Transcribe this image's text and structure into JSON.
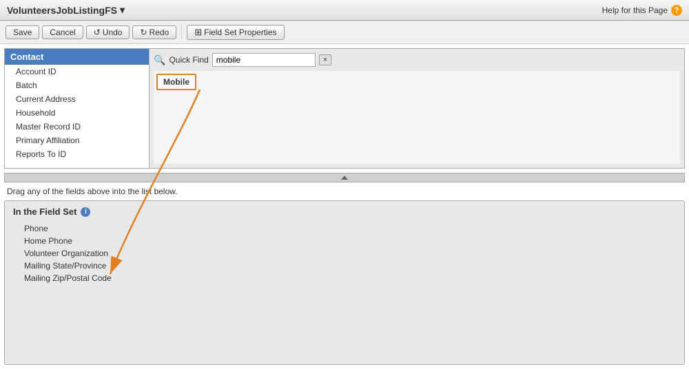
{
  "header": {
    "title": "VolunteersJobListingFS",
    "dropdown_icon": "▾",
    "help_text": "Help for this Page",
    "help_icon": "?"
  },
  "toolbar": {
    "save_label": "Save",
    "cancel_label": "Cancel",
    "undo_label": "Undo",
    "redo_label": "Redo",
    "fieldset_props_label": "Field Set Properties",
    "undo_icon": "↺",
    "redo_icon": "↻"
  },
  "contact_list": {
    "header": "Contact",
    "items": [
      {
        "label": "Account ID"
      },
      {
        "label": "Batch"
      },
      {
        "label": "Current Address"
      },
      {
        "label": "Household"
      },
      {
        "label": "Master Record ID"
      },
      {
        "label": "Primary Affiliation"
      },
      {
        "label": "Reports To ID"
      }
    ]
  },
  "search": {
    "quick_find_label": "Quick Find",
    "input_value": "mobile",
    "clear_label": "×",
    "results": [
      {
        "label": "Mobile"
      }
    ]
  },
  "drag_instruction": "Drag any of the fields above into the list below.",
  "fieldset": {
    "title": "In the Field Set",
    "info_icon": "i",
    "items": [
      {
        "label": "Phone"
      },
      {
        "label": "Home Phone"
      },
      {
        "label": "Volunteer Organization"
      },
      {
        "label": "Mailing State/Province"
      },
      {
        "label": "Mailing Zip/Postal Code"
      }
    ]
  }
}
